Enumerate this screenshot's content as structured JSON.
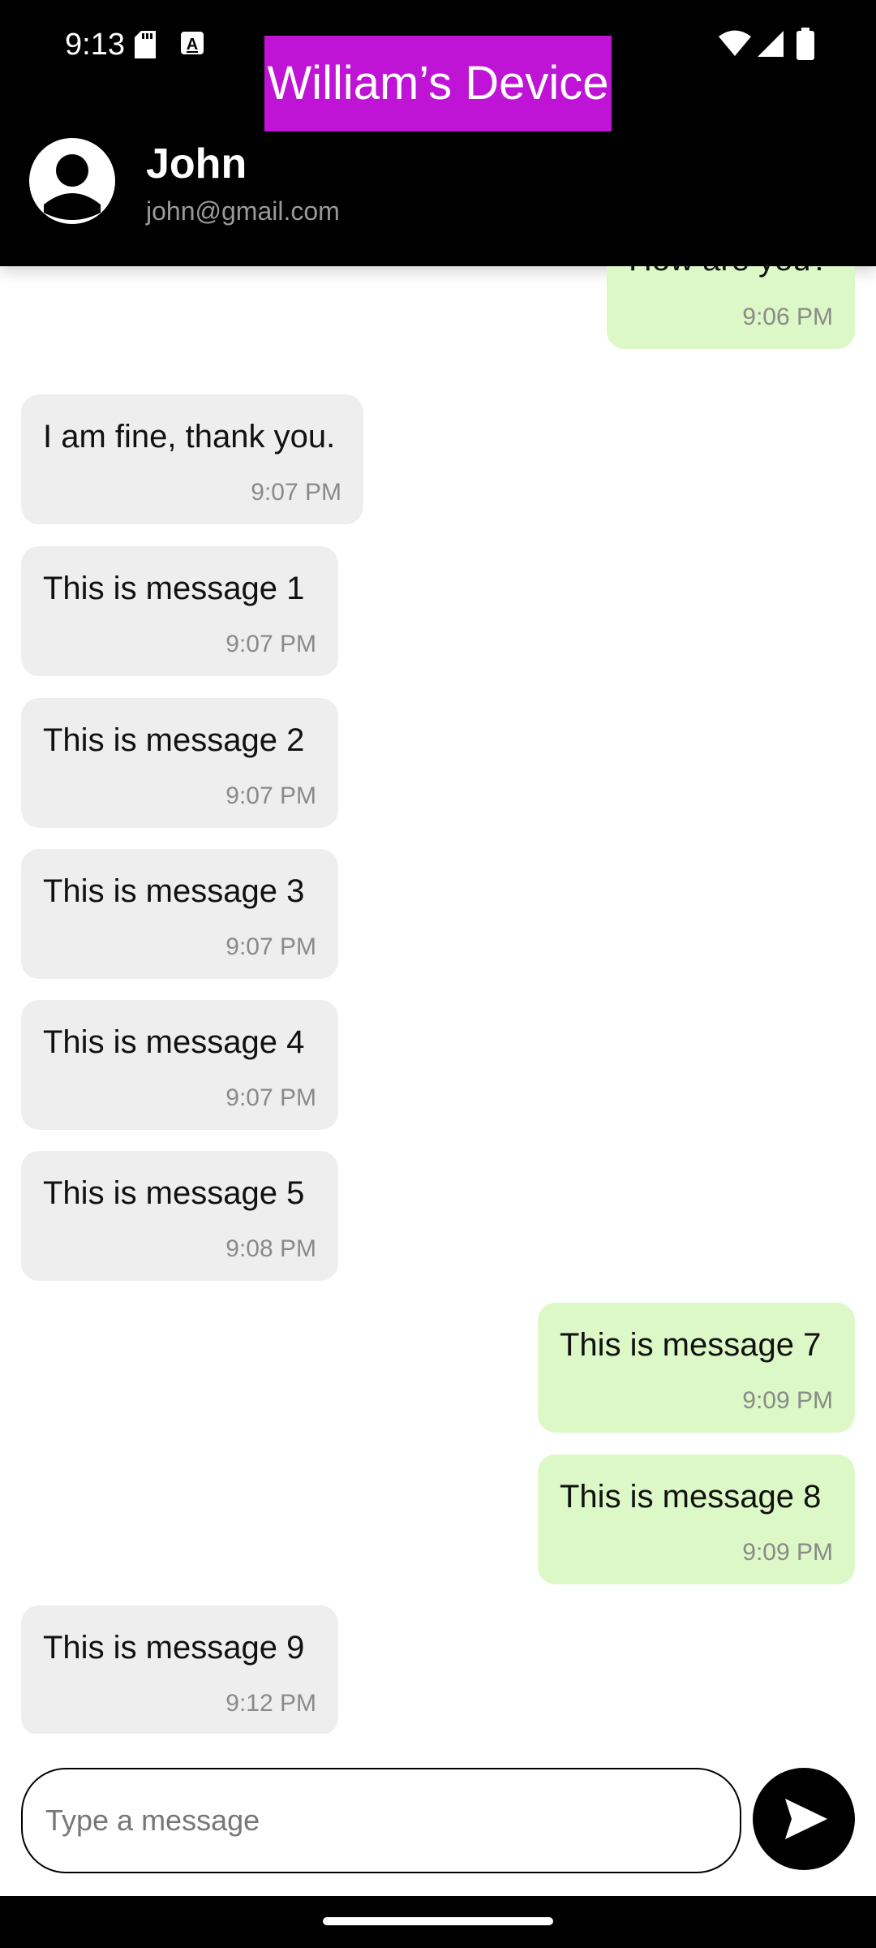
{
  "status_bar": {
    "time": "9:13",
    "icons": [
      "sd-card-icon",
      "keyboard-a-icon",
      "wifi-icon",
      "signal-icon",
      "battery-icon"
    ]
  },
  "device_banner": {
    "label": "William’s Device",
    "color": "#bf14d6"
  },
  "header": {
    "name": "John",
    "email": "john@gmail.com",
    "avatar_icon": "account-circle-icon"
  },
  "messages": [
    {
      "direction": "outgoing",
      "text": "How are you?",
      "time": "9:06 PM"
    },
    {
      "direction": "incoming",
      "text": "I am fine, thank you.",
      "time": "9:07 PM"
    },
    {
      "direction": "incoming",
      "text": "This is message 1",
      "time": "9:07 PM"
    },
    {
      "direction": "incoming",
      "text": "This is message 2",
      "time": "9:07 PM"
    },
    {
      "direction": "incoming",
      "text": "This is message 3",
      "time": "9:07 PM"
    },
    {
      "direction": "incoming",
      "text": "This is message 4",
      "time": "9:07 PM"
    },
    {
      "direction": "incoming",
      "text": "This is message 5",
      "time": "9:08 PM"
    },
    {
      "direction": "outgoing",
      "text": "This is message 7",
      "time": "9:09 PM"
    },
    {
      "direction": "outgoing",
      "text": "This is message 8",
      "time": "9:09 PM"
    },
    {
      "direction": "incoming",
      "text": "This is message 9",
      "time": "9:12 PM"
    }
  ],
  "composer": {
    "placeholder": "Type a message",
    "value": "",
    "send_icon": "send-icon"
  },
  "colors": {
    "incoming_bubble": "#eeeeee",
    "outgoing_bubble": "#dcf8c6",
    "header_bg": "#000000"
  }
}
